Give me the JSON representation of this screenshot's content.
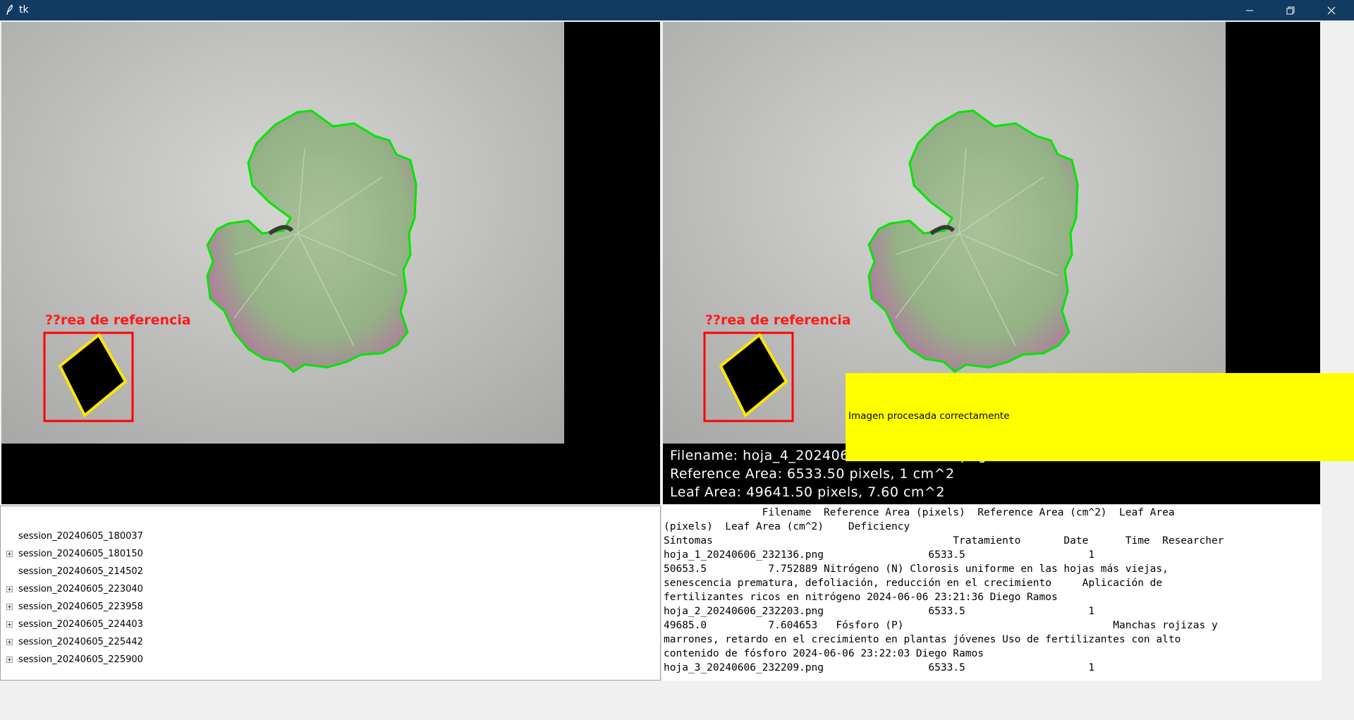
{
  "window": {
    "title": "tk",
    "buttons": [
      "minimize",
      "restore",
      "close"
    ]
  },
  "left_panel": {
    "reference_label": "??rea de referencia"
  },
  "right_panel": {
    "reference_label": "??rea de referencia",
    "info_lines": [
      "Filename: hoja_4_202406",
      "Reference Area: 6533.50 pixels, 1 cm^2",
      "Leaf Area: 49641.50 pixels, 7.60 cm^2"
    ],
    "info_line_1_suffix": "png"
  },
  "status": {
    "message": "Imagen procesada correctamente",
    "color": "#ffff00"
  },
  "tree": {
    "items": [
      {
        "label": "session_20240605_180037",
        "expandable": false
      },
      {
        "label": "session_20240605_180150",
        "expandable": true
      },
      {
        "label": "session_20240605_214502",
        "expandable": false
      },
      {
        "label": "session_20240605_223040",
        "expandable": true
      },
      {
        "label": "session_20240605_223958",
        "expandable": true
      },
      {
        "label": "session_20240605_224403",
        "expandable": true
      },
      {
        "label": "session_20240605_225442",
        "expandable": true
      },
      {
        "label": "session_20240605_225900",
        "expandable": true
      }
    ]
  },
  "results_text": {
    "lines": [
      "                Filename  Reference Area (pixels)  Reference Area (cm^2)  Leaf Area",
      "(pixels)  Leaf Area (cm^2)    Deficiency",
      "Síntomas                                       Tratamiento       Date      Time  Researcher",
      "hoja_1_20240606_232136.png                 6533.5                    1",
      "50653.5          7.752889 Nitrógeno (N) Clorosis uniforme en las hojas más viejas,",
      "senescencia prematura, defoliación, reducción en el crecimiento     Aplicación de",
      "fertilizantes ricos en nitrógeno 2024-06-06 23:21:36 Diego Ramos",
      "hoja_2_20240606_232203.png                 6533.5                    1",
      "49685.0          7.604653   Fósforo (P)                                  Manchas rojizas y",
      "marrones, retardo en el crecimiento en plantas jóvenes Uso de fertilizantes con alto",
      "contenido de fósforo 2024-06-06 23:22:03 Diego Ramos",
      "hoja_3_20240606_232209.png                 6533.5                    1"
    ]
  },
  "colors": {
    "titlebar": "#123b61",
    "contour": "#00e600",
    "reference_box": "#ff0000",
    "reference_square_outline": "#ffe600",
    "label_text": "#ff1a1a"
  }
}
